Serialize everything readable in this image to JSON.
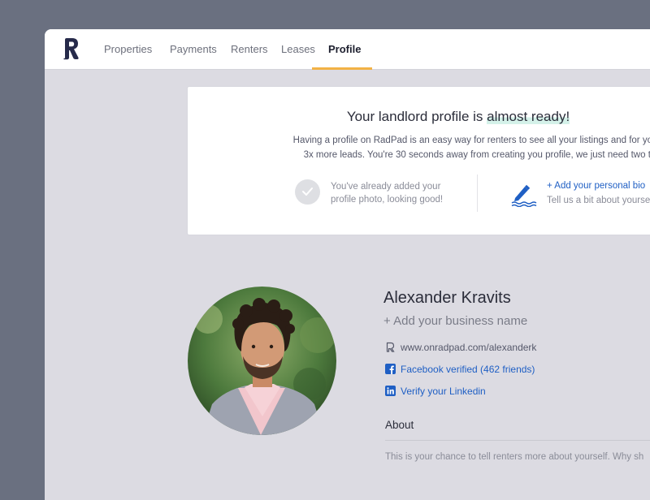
{
  "nav": {
    "items": [
      {
        "label": "Properties"
      },
      {
        "label": "Payments"
      },
      {
        "label": "Renters"
      },
      {
        "label": "Leases"
      },
      {
        "label": "Profile",
        "active": true
      }
    ],
    "accent": "#f2b245"
  },
  "banner": {
    "title_prefix": "Your landlord profile is ",
    "title_highlight": "almost ready!",
    "description_line1": "Having a profile on RadPad is an easy way for renters to see all your listings and for you to get",
    "description_line2": "3x more leads. You're 30 seconds away from creating you profile, we just need two things",
    "photo_done_line1": "You've already added your",
    "photo_done_line2": "profile photo, looking good!",
    "bio_link": "+ Add your personal bio",
    "bio_sub": "Tell us a bit about yourself"
  },
  "profile": {
    "name": "Alexander Kravits",
    "add_business": "+ Add your business name",
    "url": "www.onradpad.com/alexanderk",
    "facebook": "Facebook verified (462 friends)",
    "linkedin": "Verify your Linkedin",
    "about_title": "About",
    "about_placeholder": "This is your chance to tell renters more about yourself. Why sh"
  },
  "icons": {
    "logo": "radpad-logo-icon",
    "check": "check-icon",
    "pencil": "pencil-icon",
    "link": "radpad-link-icon",
    "facebook": "facebook-icon",
    "linkedin": "linkedin-icon"
  },
  "colors": {
    "link_blue": "#1f5fc4",
    "highlight": "#d4f1e9",
    "background": "#dcdbe2"
  }
}
